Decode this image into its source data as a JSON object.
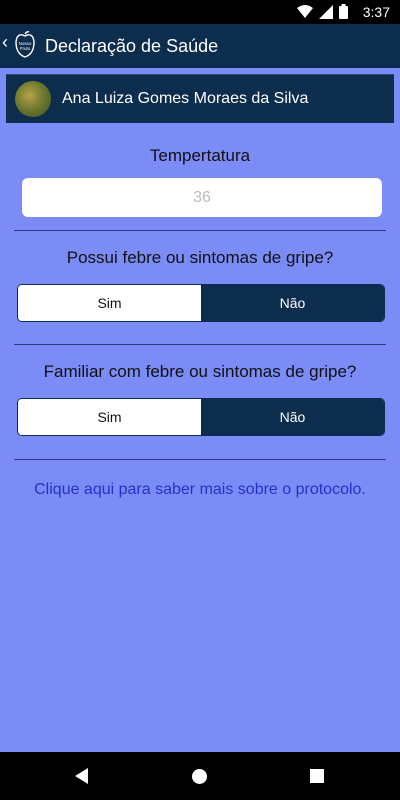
{
  "status_bar": {
    "time": "3:37",
    "icons": [
      "wifi-icon",
      "signal-icon",
      "battery-icon"
    ]
  },
  "app_bar": {
    "title": "Declaração de Saúde",
    "back_icon": "chevron-left-icon",
    "logo_text": "Nosso Fruto"
  },
  "user": {
    "name": "Ana Luiza Gomes Moraes da Silva"
  },
  "temperature": {
    "label": "Tempertatura",
    "placeholder": "36",
    "value": ""
  },
  "question1": {
    "label": "Possui febre ou sintomas de gripe?",
    "options": [
      "Sim",
      "Não"
    ],
    "selected": "Não"
  },
  "question2": {
    "label": "Familiar com febre ou sintomas de gripe?",
    "options": [
      "Sim",
      "Não"
    ],
    "selected": "Não"
  },
  "link": {
    "text": "Clique aqui para saber mais sobre o protocolo."
  },
  "nav_bar": {
    "icons": [
      "back-icon",
      "home-icon",
      "recent-apps-icon"
    ]
  },
  "colors": {
    "background": "#7b8cf6",
    "primary": "#0c2d4d",
    "link": "#2333c9"
  }
}
